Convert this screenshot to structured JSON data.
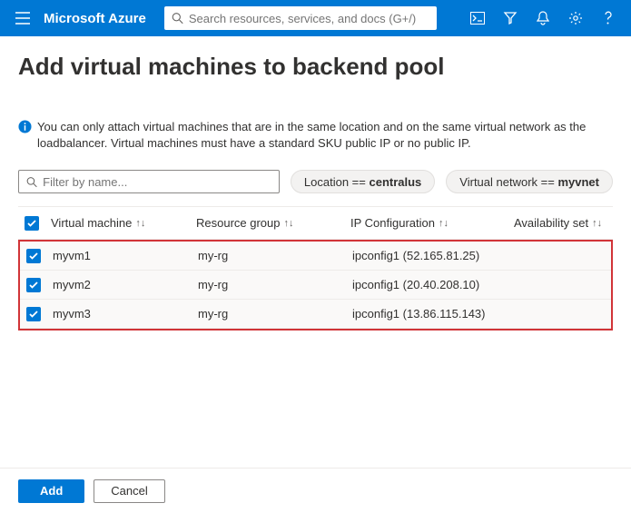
{
  "topbar": {
    "brand": "Microsoft Azure",
    "search_placeholder": "Search resources, services, and docs (G+/)"
  },
  "page": {
    "title": "Add virtual machines to backend pool",
    "info_text": "You can only attach virtual machines that are in the same location and on the same virtual network as the loadbalancer. Virtual machines must have a standard SKU public IP or no public IP."
  },
  "filter": {
    "placeholder": "Filter by name...",
    "chip_location_label": "Location ==",
    "chip_location_value": "centralus",
    "chip_vnet_label": "Virtual network ==",
    "chip_vnet_value": "myvnet"
  },
  "columns": {
    "vm": "Virtual machine",
    "rg": "Resource group",
    "ip": "IP Configuration",
    "av": "Availability set"
  },
  "rows": [
    {
      "vm": "myvm1",
      "rg": "my-rg",
      "ip": "ipconfig1 (52.165.81.25)",
      "checked": true
    },
    {
      "vm": "myvm2",
      "rg": "my-rg",
      "ip": "ipconfig1 (20.40.208.10)",
      "checked": true
    },
    {
      "vm": "myvm3",
      "rg": "my-rg",
      "ip": "ipconfig1 (13.86.115.143)",
      "checked": true
    }
  ],
  "footer": {
    "add": "Add",
    "cancel": "Cancel"
  }
}
